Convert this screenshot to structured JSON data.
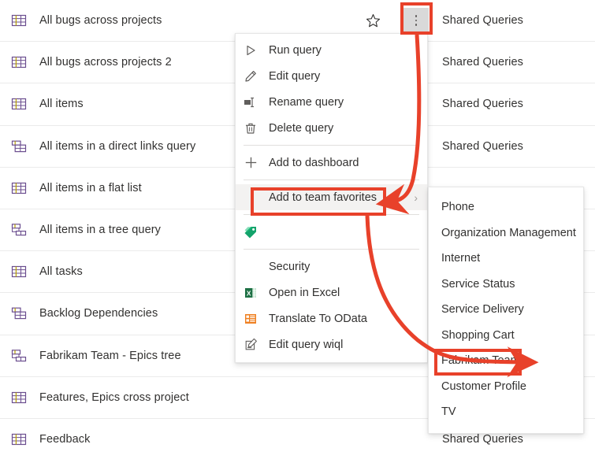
{
  "list": {
    "folder_label": "Shared Queries",
    "rows": [
      {
        "title": "All bugs across projects",
        "icon": "flat-query-icon",
        "folder": "Shared Queries",
        "has_star": true,
        "has_more": true
      },
      {
        "title": "All bugs across projects 2",
        "icon": "flat-query-icon",
        "folder": "Shared Queries",
        "has_star": false,
        "has_more": false
      },
      {
        "title": "All items",
        "icon": "flat-query-icon",
        "folder": "Shared Queries",
        "has_star": false,
        "has_more": false
      },
      {
        "title": "All items in a direct links query",
        "icon": "direct-links-query-icon",
        "folder": "Shared Queries",
        "has_star": false,
        "has_more": false
      },
      {
        "title": "All items in a flat list",
        "icon": "flat-query-icon",
        "folder": "",
        "has_star": false,
        "has_more": false
      },
      {
        "title": "All items in a tree query",
        "icon": "tree-query-icon",
        "folder": "",
        "has_star": false,
        "has_more": false
      },
      {
        "title": "All tasks",
        "icon": "flat-query-icon",
        "folder": "",
        "has_star": false,
        "has_more": false
      },
      {
        "title": "Backlog Dependencies",
        "icon": "direct-links-query-icon",
        "folder": "",
        "has_star": false,
        "has_more": false
      },
      {
        "title": "Fabrikam Team - Epics tree",
        "icon": "tree-query-icon",
        "folder": "",
        "has_star": false,
        "has_more": false
      },
      {
        "title": "Features, Epics cross project",
        "icon": "flat-query-icon",
        "folder": "",
        "has_star": false,
        "has_more": false
      },
      {
        "title": "Feedback",
        "icon": "flat-query-icon",
        "folder": "Shared Queries",
        "has_star": false,
        "has_more": false
      }
    ]
  },
  "context_menu": {
    "items": [
      {
        "label": "Run query",
        "icon": "play-icon",
        "type": "item"
      },
      {
        "label": "Edit query",
        "icon": "pencil-icon",
        "type": "item"
      },
      {
        "label": "Rename query",
        "icon": "rename-icon",
        "type": "item"
      },
      {
        "label": "Delete query",
        "icon": "trash-icon",
        "type": "item"
      },
      {
        "label": "",
        "icon": "",
        "type": "separator"
      },
      {
        "label": "Add to dashboard",
        "icon": "plus-icon",
        "type": "item"
      },
      {
        "label": "",
        "icon": "",
        "type": "separator"
      },
      {
        "label": "Add to team favorites",
        "icon": "",
        "type": "submenu",
        "highlighted": true
      },
      {
        "label": "",
        "icon": "",
        "type": "separator"
      },
      {
        "label": "",
        "icon": "tag-icon",
        "type": "item"
      },
      {
        "label": "",
        "icon": "",
        "type": "separator"
      },
      {
        "label": "Security",
        "icon": "",
        "type": "item"
      },
      {
        "label": "Open in Excel",
        "icon": "excel-icon",
        "type": "item"
      },
      {
        "label": "Translate To OData",
        "icon": "odata-icon",
        "type": "item"
      },
      {
        "label": "Edit query wiql",
        "icon": "wiql-icon",
        "type": "item"
      }
    ]
  },
  "submenu": {
    "items": [
      {
        "label": "Phone"
      },
      {
        "label": "Organization Management"
      },
      {
        "label": "Internet"
      },
      {
        "label": "Service Status"
      },
      {
        "label": "Service Delivery"
      },
      {
        "label": "Shopping Cart"
      },
      {
        "label": "Fabrikam Team",
        "highlighted": true
      },
      {
        "label": "Customer Profile"
      },
      {
        "label": "TV"
      }
    ]
  },
  "annotations": {
    "highlight_color": "#e8412a",
    "boxes": [
      {
        "name": "more-actions-button"
      },
      {
        "name": "add-to-team-favorites-item"
      },
      {
        "name": "fabrikam-team-submenu-item"
      }
    ]
  }
}
